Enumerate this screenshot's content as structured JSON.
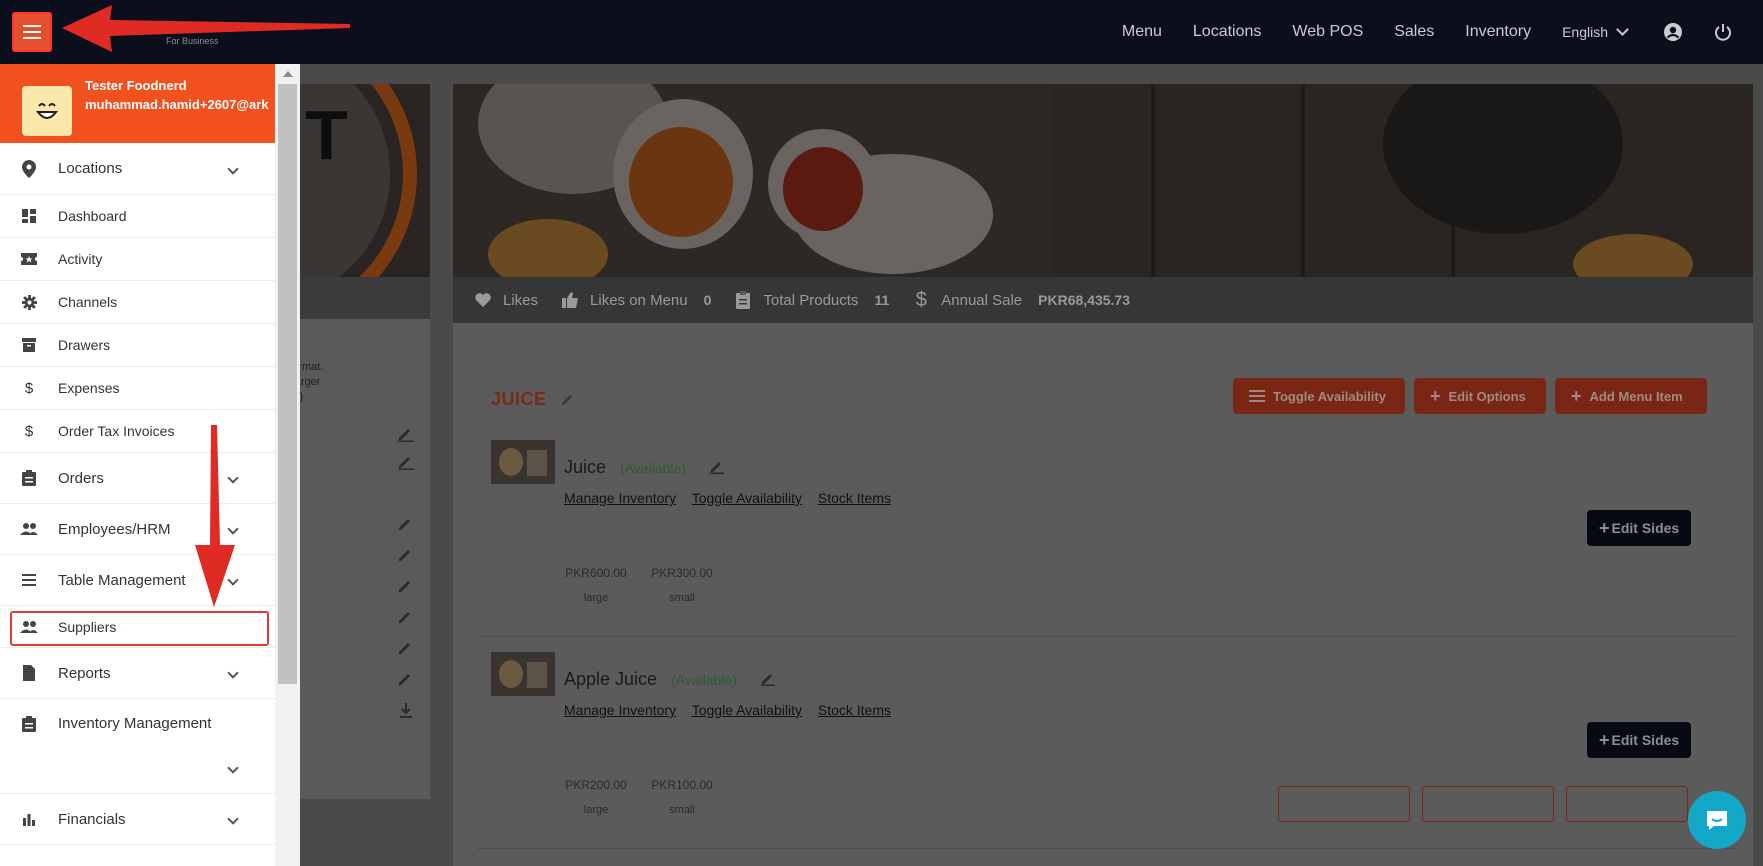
{
  "app": {
    "logo_sub": "For Business"
  },
  "topnav": {
    "items": [
      "Menu",
      "Locations",
      "Web POS",
      "Sales",
      "Inventory"
    ],
    "language": "English"
  },
  "sidebar": {
    "user_name": "Tester Foodnerd",
    "user_email": "muhammad.hamid+2607@ark",
    "items": [
      {
        "label": "Locations",
        "icon": "location-pin-icon",
        "expandable": true
      },
      {
        "label": "Dashboard",
        "icon": "dashboard-icon"
      },
      {
        "label": "Activity",
        "icon": "ticket-icon"
      },
      {
        "label": "Channels",
        "icon": "gear-icon"
      },
      {
        "label": "Drawers",
        "icon": "archive-icon"
      },
      {
        "label": "Expenses",
        "icon": "dollar-icon"
      },
      {
        "label": "Order Tax Invoices",
        "icon": "dollar-icon"
      },
      {
        "label": "Orders",
        "icon": "clipboard-icon",
        "expandable": true
      },
      {
        "label": "Employees/HRM",
        "icon": "people-icon",
        "expandable": true
      },
      {
        "label": "Table Management",
        "icon": "list-icon",
        "expandable": true
      },
      {
        "label": "Suppliers",
        "icon": "people-icon"
      },
      {
        "label": "Reports",
        "icon": "document-icon",
        "expandable": true
      },
      {
        "label": "Inventory Management",
        "icon": "clipboard-icon",
        "expandable": true
      },
      {
        "label": "Financials",
        "icon": "bar-chart-icon",
        "expandable": true
      }
    ]
  },
  "left_card": {
    "text_lines": [
      "g format.",
      "k (larger",
      "size)"
    ]
  },
  "stats": {
    "likes_label": "Likes",
    "likes_on_menu_label": "Likes on Menu",
    "likes_on_menu_value": "0",
    "total_products_label": "Total Products",
    "total_products_value": "11",
    "annual_sale_label": "Annual Sale",
    "annual_sale_value": "PKR68,435.73"
  },
  "section": {
    "title": "JUICE",
    "toggle_availability": "Toggle Availability",
    "edit_options": "Edit Options",
    "add_menu_item": "Add Menu Item"
  },
  "items": [
    {
      "name": "Juice",
      "availability": "(Available)",
      "links": [
        "Manage Inventory",
        "Toggle Availability",
        "Stock Items"
      ],
      "prices": [
        {
          "price": "PKR600.00",
          "size": "large"
        },
        {
          "price": "PKR300.00",
          "size": "small"
        }
      ],
      "edit_sides": "Edit Sides"
    },
    {
      "name": "Apple Juice",
      "availability": "(Available)",
      "links": [
        "Manage Inventory",
        "Toggle Availability",
        "Stock Items"
      ],
      "prices": [
        {
          "price": "PKR200.00",
          "size": "large"
        },
        {
          "price": "PKR100.00",
          "size": "small"
        }
      ],
      "edit_sides": "Edit Sides"
    }
  ],
  "colors": {
    "accent": "#f1511f",
    "dark_button": "#0b0f1c",
    "annotation": "#e53935",
    "chat": "#14a8c8"
  }
}
